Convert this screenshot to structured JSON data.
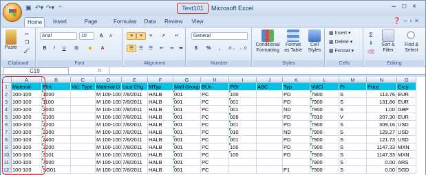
{
  "titlebar": {
    "file_name": "Test101",
    "app_name": "Microsoft Excel",
    "qat_icons": [
      "save-icon",
      "undo-icon",
      "redo-icon"
    ]
  },
  "tabs": [
    "Home",
    "Insert",
    "Page Layout",
    "Formulas",
    "Data",
    "Review",
    "View"
  ],
  "ribbon": {
    "clipboard": {
      "label": "Clipboard",
      "paste": "Paste"
    },
    "font": {
      "label": "Font",
      "name": "Arial",
      "size": "10",
      "size_up": "A",
      "size_down": "A",
      "bold": "B",
      "italic": "I",
      "underline": "U",
      "font_color": "A"
    },
    "alignment": {
      "label": "Alignment"
    },
    "number": {
      "label": "Number",
      "format": "General",
      "currency": "$",
      "percent": "%",
      "comma": ","
    },
    "styles": {
      "label": "Styles",
      "conditional": [
        "Conditional",
        "Formatting"
      ],
      "format_table": [
        "Format",
        "as Table"
      ],
      "cell_styles": [
        "Cell",
        "Styles"
      ]
    },
    "cells": {
      "label": "Cells",
      "insert": "Insert",
      "delete": "Delete",
      "format": "Format"
    },
    "editing": {
      "label": "Editing",
      "sort": [
        "Sort &",
        "Filter"
      ],
      "find": [
        "Find &",
        "Select"
      ]
    }
  },
  "formula_bar": {
    "name_box": "C19",
    "fx": "fx",
    "formula": ""
  },
  "sheet": {
    "columns": [
      "A",
      "B",
      "C",
      "D",
      "E",
      "F",
      "G",
      "H",
      "I",
      "J",
      "K",
      "L",
      "M",
      "N",
      "O"
    ],
    "rows": [
      [
        "Material",
        "Plnt",
        "Val. Type",
        "Material D",
        "Last Chg",
        "MTyp",
        "Matl Group",
        "BUn",
        "PGr",
        "ABC",
        "Typ",
        "ValCl",
        "Pr",
        "Price",
        "Crcy"
      ],
      [
        "100-100",
        "1000",
        "",
        "M 100-100",
        "7/8/2011",
        "HALB",
        "001",
        "PC",
        "100",
        "",
        "PD",
        "7900",
        "S",
        "113.76",
        "EUR"
      ],
      [
        "100-100",
        "1100",
        "",
        "M 100-100",
        "7/8/2011",
        "HALB",
        "001",
        "PC",
        "001",
        "",
        "PD",
        "7900",
        "S",
        "131.86",
        "EUR"
      ],
      [
        "100-100",
        "2000",
        "",
        "M 100-100",
        "7/8/2011",
        "HALB",
        "001",
        "PC",
        "001",
        "",
        "ND",
        "7900",
        "S",
        "1.00",
        "GBP"
      ],
      [
        "100-100",
        "2100",
        "",
        "M 100-100",
        "7/8/2011",
        "HALB",
        "001",
        "PC",
        "026",
        "",
        "PD",
        "7910",
        "V",
        "207.30",
        "EUR"
      ],
      [
        "100-100",
        "2200",
        "",
        "M 100-100",
        "7/8/2011",
        "HALB",
        "001",
        "PC",
        "001",
        "",
        "PD",
        "7900",
        "S",
        "309.16",
        "USD"
      ],
      [
        "100-100",
        "2300",
        "",
        "M 100-100",
        "7/8/2011",
        "HALB",
        "001",
        "PC",
        "010",
        "",
        "ND",
        "7900",
        "S",
        "129.27",
        "USD"
      ],
      [
        "100-100",
        "2400",
        "",
        "M 100-100",
        "7/8/2011",
        "HALB",
        "001",
        "PC",
        "001",
        "",
        "PD",
        "7900",
        "S",
        "121.73",
        "USD"
      ],
      [
        "100-100",
        "3200",
        "",
        "M 100-100",
        "7/8/2011",
        "HALB",
        "001",
        "PC",
        "100",
        "",
        "PD",
        "7900",
        "S",
        "1147.33",
        "MXN"
      ],
      [
        "100-100",
        "3101",
        "",
        "M 100-100",
        "7/8/2011",
        "HALB",
        "001",
        "PC",
        "100",
        "",
        "PD",
        "7900",
        "S",
        "1147.33",
        "MXN"
      ],
      [
        "100-100",
        "7500",
        "",
        "M 100-100",
        "7/8/2011",
        "HALB",
        "001",
        "PC",
        "",
        "",
        "",
        "7900",
        "S",
        "0.00",
        "ARS"
      ],
      [
        "100-100",
        "SG01",
        "",
        "M 100-100",
        "7/8/2011",
        "HALB",
        "001",
        "PC",
        "",
        "",
        "P1",
        "7900",
        "S",
        "0.00",
        "SGD"
      ]
    ]
  }
}
